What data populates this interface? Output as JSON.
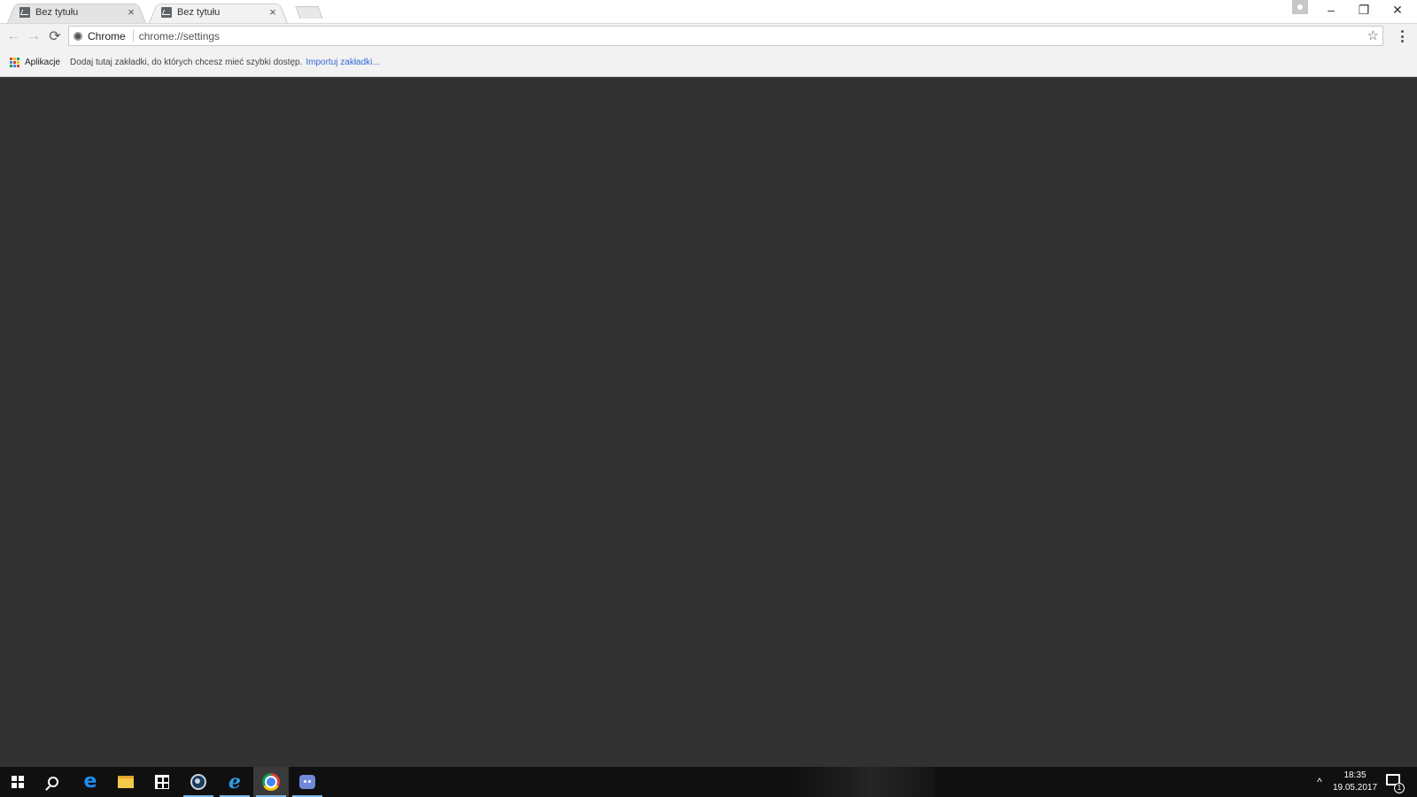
{
  "tabs": [
    {
      "title": "Bez tytułu",
      "active": false,
      "favicon": "page-icon",
      "close": "×"
    },
    {
      "title": "Bez tytułu",
      "active": true,
      "favicon": "page-icon",
      "close": "×"
    }
  ],
  "window_controls": {
    "minimize": "–",
    "restore": "❐",
    "close": "✕"
  },
  "toolbar": {
    "back": "←",
    "forward": "→",
    "reload": "⟳",
    "security_chip_label": "Chrome",
    "url": "chrome://settings",
    "bookmark_star": "☆"
  },
  "bookmarks_bar": {
    "apps_label": "Aplikacje",
    "apps_colors": [
      "#db4437",
      "#f4c20d",
      "#0f9d58",
      "#4285f4",
      "#db4437",
      "#f4c20d",
      "#0f9d58",
      "#4285f4",
      "#db4437"
    ],
    "hint": "Dodaj tutaj zakładki, do których chcesz mieć szybki dostęp.",
    "import_link": "Importuj zakładki..."
  },
  "taskbar": {
    "items": [
      {
        "name": "start-button",
        "icon": "windows-logo"
      },
      {
        "name": "search-button",
        "icon": "search-icon"
      },
      {
        "name": "edge",
        "icon": "edge-icon",
        "glyph": "e"
      },
      {
        "name": "file-explorer",
        "icon": "folder-icon"
      },
      {
        "name": "store",
        "icon": "store-icon"
      },
      {
        "name": "steam",
        "icon": "steam-icon"
      },
      {
        "name": "internet-explorer",
        "icon": "ie-icon",
        "glyph": "e"
      },
      {
        "name": "chrome",
        "icon": "chrome-icon"
      },
      {
        "name": "discord",
        "icon": "discord-icon"
      }
    ],
    "tray_chevron": "^",
    "time": "18:35",
    "date": "19.05.2017",
    "notification_count": "1"
  },
  "colors": {
    "content_background": "#323232",
    "taskbar_background": "#101010",
    "link": "#3367d6",
    "taskbar_active_indicator": "#76b9ed"
  }
}
